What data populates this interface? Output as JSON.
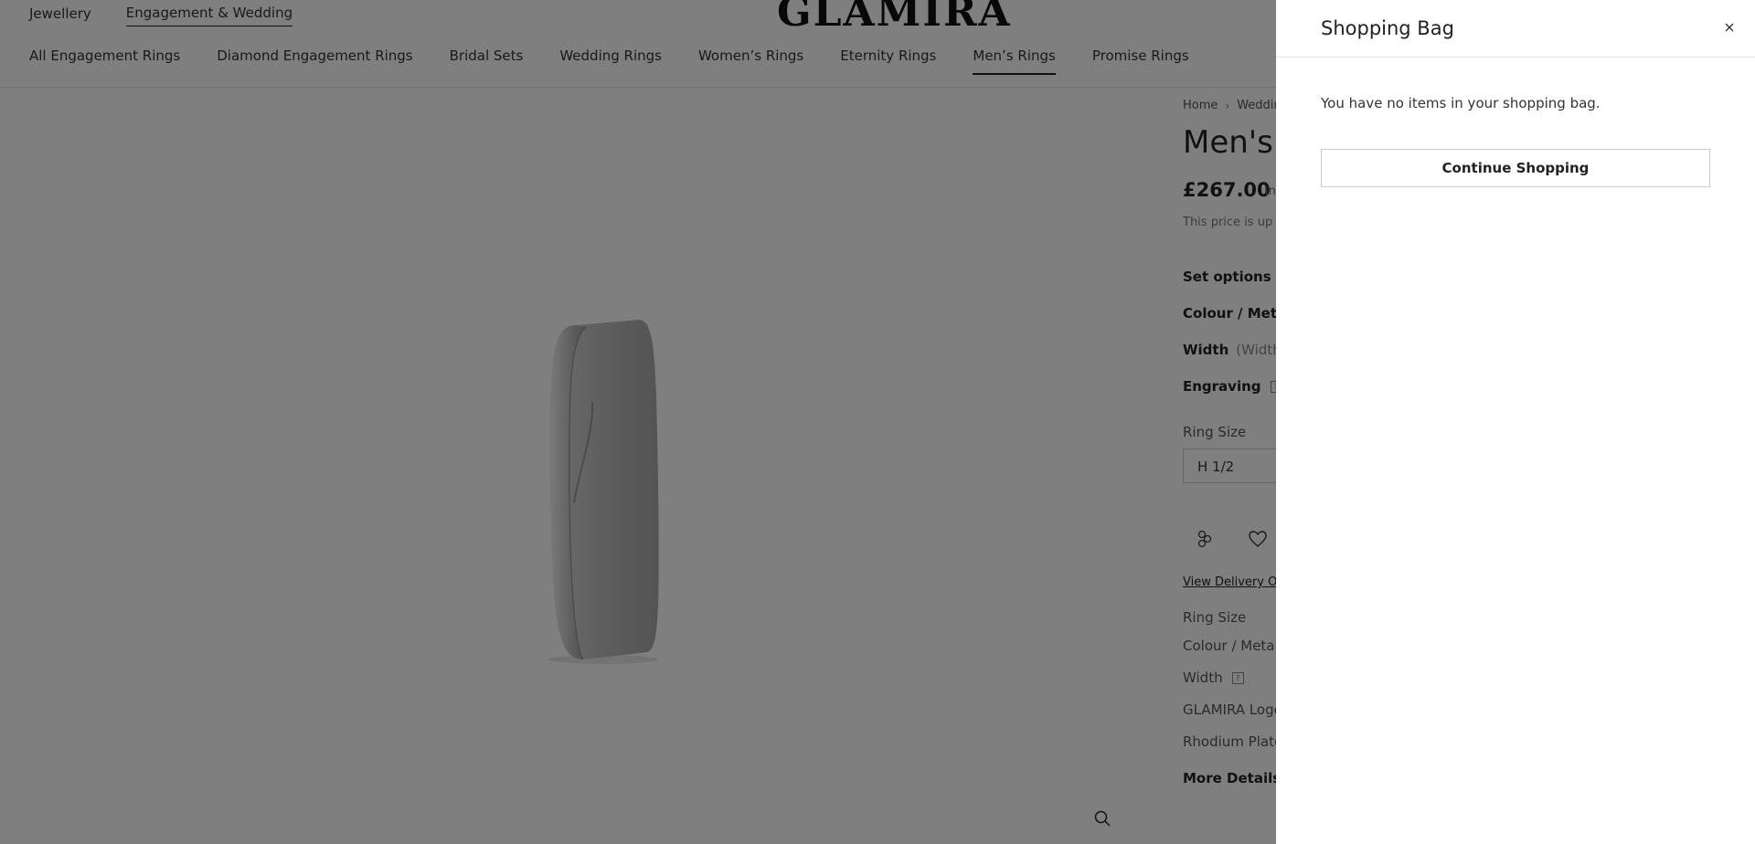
{
  "header": {
    "top_links": [
      {
        "label": "Jewellery",
        "active": false
      },
      {
        "label": "Engagement & Wedding",
        "active": true
      }
    ],
    "logo": "GLAMIRA",
    "categories": [
      {
        "label": "All Engagement Rings",
        "active": false
      },
      {
        "label": "Diamond Engagement Rings",
        "active": false
      },
      {
        "label": "Bridal Sets",
        "active": false
      },
      {
        "label": "Wedding Rings",
        "active": false
      },
      {
        "label": "Women’s Rings",
        "active": false
      },
      {
        "label": "Eternity Rings",
        "active": false
      },
      {
        "label": "Men’s Rings",
        "active": true
      },
      {
        "label": "Promise Rings",
        "active": false
      }
    ]
  },
  "product": {
    "breadcrumb": [
      "Home",
      "Weddin"
    ],
    "title": "Men's",
    "price": "£267.00",
    "price_suffix": "in",
    "price_note": "This price is up to",
    "options": {
      "set_options": "Set options",
      "colour_metal": "Colour / Metal",
      "width": "Width",
      "width_hint": "(Width",
      "engraving": "Engraving",
      "help_glyph": "?"
    },
    "ring_size_label": "Ring Size",
    "ring_size_value": "H 1/2",
    "delivery_link": "View Delivery Op",
    "specs": {
      "ring_size": "Ring Size",
      "colour_metal": "Colour / Metal",
      "width": "Width",
      "logo": "GLAMIRA Logo",
      "plating": "Rhodium Plate"
    },
    "more_details": "More Details"
  },
  "icons": {
    "compare": "compare-icon",
    "wishlist": "heart-icon",
    "zoom": "search-icon",
    "close": "close-icon"
  },
  "drawer": {
    "title": "Shopping Bag",
    "empty_message": "You have no items in your shopping bag.",
    "continue_label": "Continue Shopping"
  },
  "colors": {
    "overlay": "rgba(0,0,0,0.5)",
    "text": "#222222",
    "border": "#cccccc"
  }
}
